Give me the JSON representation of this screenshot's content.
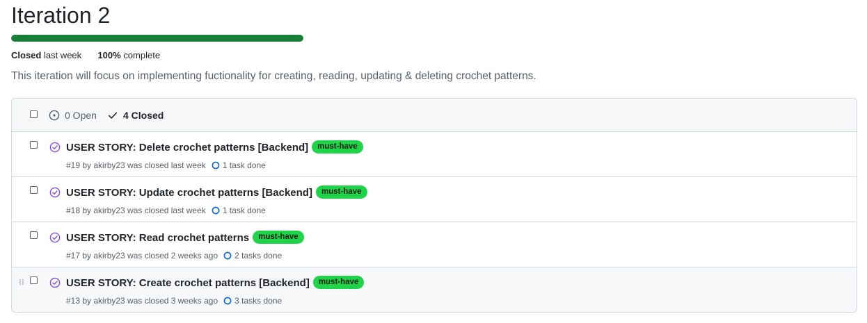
{
  "iteration": {
    "title": "Iteration 2",
    "progress_fraction": 1.0,
    "closed_bold": "Closed",
    "closed_when": "last week",
    "percent_bold": "100%",
    "percent_text": "complete",
    "description": "This iteration will focus on implementing fuctionality for creating, reading, updating & deleting crochet patterns."
  },
  "filters": {
    "open_label": "0 Open",
    "closed_label": "4 Closed"
  },
  "issues": [
    {
      "title": "USER STORY: Delete crochet patterns [Backend]",
      "label": "must-have",
      "meta": "#19 by akirby23 was closed last week",
      "tasks": "1 task done"
    },
    {
      "title": "USER STORY: Update crochet patterns [Backend]",
      "label": "must-have",
      "meta": "#18 by akirby23 was closed last week",
      "tasks": "1 task done"
    },
    {
      "title": "USER STORY: Read crochet patterns",
      "label": "must-have",
      "meta": "#17 by akirby23 was closed 2 weeks ago",
      "tasks": "2 tasks done"
    },
    {
      "title": "USER STORY: Create crochet patterns [Backend]",
      "label": "must-have",
      "meta": "#13 by akirby23 was closed 3 weeks ago",
      "tasks": "3 tasks done"
    }
  ],
  "colors": {
    "progress": "#1a7f37",
    "label_bg": "#20d44a",
    "closed_icon": "#8250df",
    "task_icon": "#0969da"
  }
}
